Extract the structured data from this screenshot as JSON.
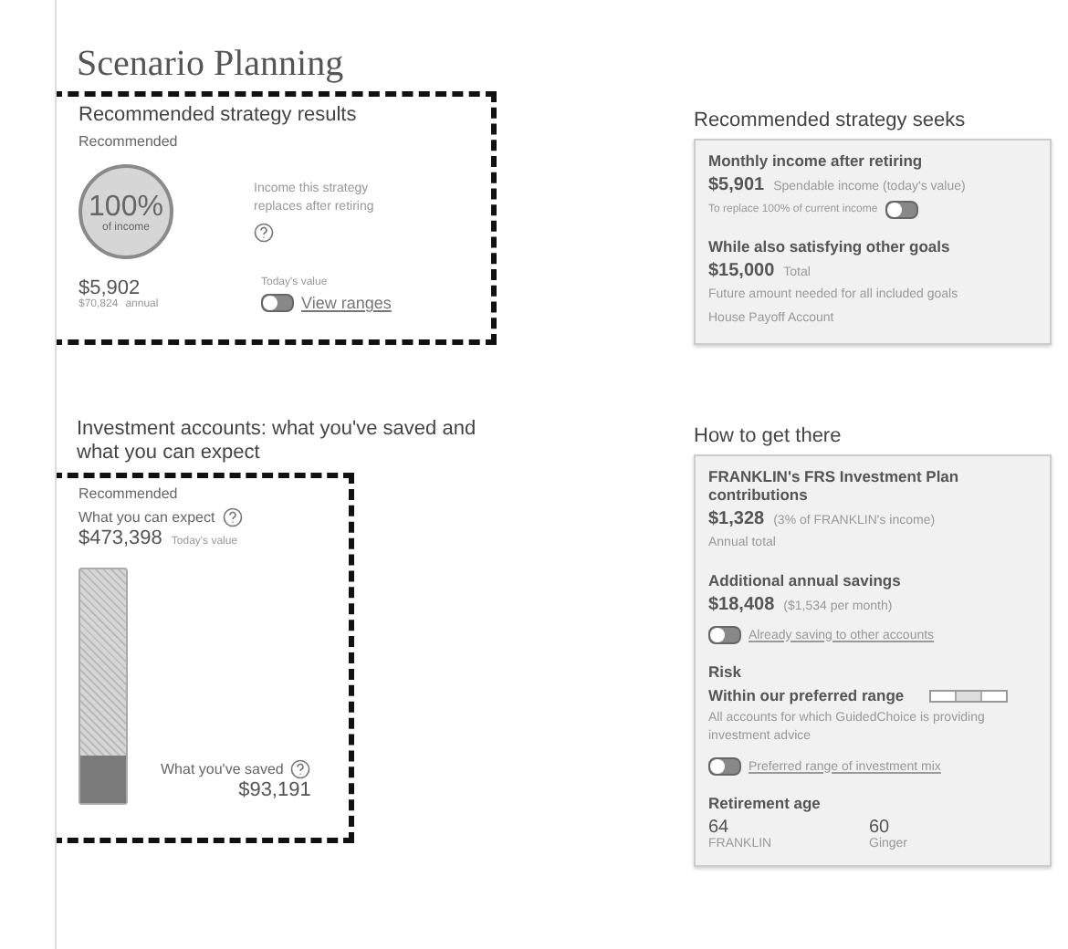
{
  "page_title": "Scenario Planning",
  "results": {
    "heading": "Recommended strategy results",
    "tag": "Recommended",
    "percent": "100%",
    "percent_caption": "of income",
    "description": "Income this strategy replaces after retiring",
    "monthly": "$5,902",
    "annual": "$70,824",
    "annual_label": "annual",
    "value_note": "Today's value",
    "toggle_on": false,
    "link": "View ranges"
  },
  "seeks": {
    "heading": "Recommended strategy seeks",
    "sections": [
      {
        "title": "Monthly income after retiring",
        "amount": "$5,901",
        "amount_note": "Spendable income (today's value)",
        "toggle": {
          "text": "To replace 100% of current income",
          "on": false
        }
      },
      {
        "title": "While also satisfying other goals",
        "amount": "$15,000",
        "amount_note": "Total",
        "notes": [
          "Future amount needed for all included goals",
          "House Payoff Account"
        ]
      }
    ]
  },
  "investment": {
    "heading": "Investment accounts: what you've saved and what you can expect",
    "tag": "Recommended",
    "expect_label": "What you can expect",
    "expect_amount": "$473,398",
    "expect_note": "Today's value",
    "saved_label": "What you've saved",
    "saved_amount": "$93,191",
    "level": 0.2
  },
  "how": {
    "heading": "How to get there",
    "sections": [
      {
        "kind": "amount",
        "title": "FRANKLIN's FRS Investment Plan contributions",
        "amount": "$1,328",
        "amount_note": "(3% of FRANKLIN's income)",
        "notes": [
          "Annual total"
        ]
      },
      {
        "kind": "amount",
        "title": "Additional annual savings",
        "amount": "$18,408",
        "amount_note": "($1,534 per month)",
        "toggle": {
          "on": false,
          "link": "Already saving to other accounts"
        }
      },
      {
        "kind": "risk",
        "label": "Risk",
        "title": "Within our preferred range",
        "notes": [
          "All accounts for which GuidedChoice is providing investment advice"
        ],
        "toggle": {
          "on": false,
          "link": "Preferred range of investment mix"
        }
      },
      {
        "kind": "ages",
        "label": "Retirement age",
        "people": [
          {
            "age": "64",
            "name": "FRANKLIN"
          },
          {
            "age": "60",
            "name": "Ginger"
          }
        ]
      }
    ]
  }
}
